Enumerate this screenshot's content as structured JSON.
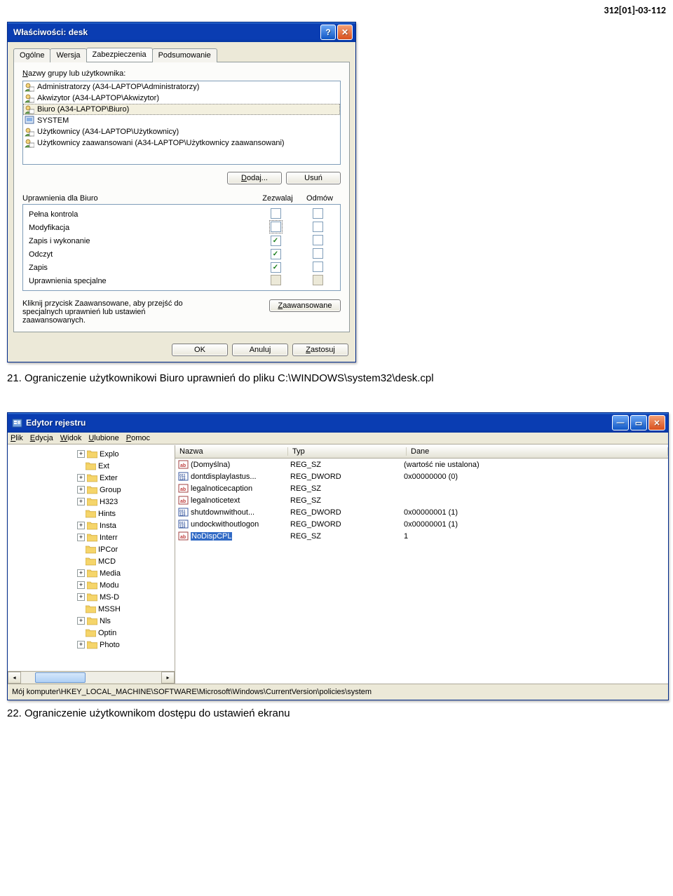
{
  "page_header": "312[01]-03-112",
  "dialog": {
    "title": "Właściwości: desk",
    "tabs": [
      "Ogólne",
      "Wersja",
      "Zabezpieczenia",
      "Podsumowanie"
    ],
    "active_tab": 2,
    "groups_label": "Nazwy grupy lub użytkownika:",
    "users": [
      "Administratorzy (A34-LAPTOP\\Administratorzy)",
      "Akwizytor (A34-LAPTOP\\Akwizytor)",
      "Biuro (A34-LAPTOP\\Biuro)",
      "SYSTEM",
      "Użytkownicy (A34-LAPTOP\\Użytkownicy)",
      "Użytkownicy zaawansowani (A34-LAPTOP\\Użytkownicy zaawansowani)"
    ],
    "selected_user_index": 2,
    "add_btn": "Dodaj...",
    "remove_btn": "Usuń",
    "perm_for": "Uprawnienia dla Biuro",
    "allow": "Zezwalaj",
    "deny": "Odmów",
    "permissions": [
      {
        "name": "Pełna kontrola",
        "allow": false,
        "deny": false,
        "allow_grey": false
      },
      {
        "name": "Modyfikacja",
        "allow": false,
        "deny": false,
        "allow_grey": false,
        "allow_focus": true
      },
      {
        "name": "Zapis i wykonanie",
        "allow": true,
        "deny": false,
        "allow_grey": false
      },
      {
        "name": "Odczyt",
        "allow": true,
        "deny": false,
        "allow_grey": false
      },
      {
        "name": "Zapis",
        "allow": true,
        "deny": false,
        "allow_grey": false
      },
      {
        "name": "Uprawnienia specjalne",
        "allow": false,
        "deny": false,
        "allow_grey": true
      }
    ],
    "adv_text": "Kliknij przycisk Zaawansowane, aby przejść do specjalnych uprawnień lub ustawień zaawansowanych.",
    "adv_btn": "Zaawansowane",
    "ok": "OK",
    "cancel": "Anuluj",
    "apply": "Zastosuj"
  },
  "caption1": "21. Ograniczenie użytkownikowi Biuro uprawnień do pliku C:\\WINDOWS\\system32\\desk.cpl",
  "regedit": {
    "title": "Edytor rejestru",
    "menu": [
      "Plik",
      "Edycja",
      "Widok",
      "Ulubione",
      "Pomoc"
    ],
    "tree": [
      {
        "exp": "+",
        "label": "Explo"
      },
      {
        "exp": "",
        "label": "Ext"
      },
      {
        "exp": "+",
        "label": "Exter"
      },
      {
        "exp": "+",
        "label": "Group"
      },
      {
        "exp": "+",
        "label": "H323"
      },
      {
        "exp": "",
        "label": "Hints"
      },
      {
        "exp": "+",
        "label": "Insta"
      },
      {
        "exp": "+",
        "label": "Interr"
      },
      {
        "exp": "",
        "label": "IPCor"
      },
      {
        "exp": "",
        "label": "MCD"
      },
      {
        "exp": "+",
        "label": "Media"
      },
      {
        "exp": "+",
        "label": "Modu"
      },
      {
        "exp": "+",
        "label": "MS-D"
      },
      {
        "exp": "",
        "label": "MSSH"
      },
      {
        "exp": "+",
        "label": "Nls"
      },
      {
        "exp": "",
        "label": "Optin"
      },
      {
        "exp": "+",
        "label": "Photo"
      }
    ],
    "columns": [
      "Nazwa",
      "Typ",
      "Dane"
    ],
    "values": [
      {
        "icon": "sz",
        "name": "(Domyślna)",
        "type": "REG_SZ",
        "data": "(wartość nie ustalona)"
      },
      {
        "icon": "dw",
        "name": "dontdisplaylastus...",
        "type": "REG_DWORD",
        "data": "0x00000000 (0)"
      },
      {
        "icon": "sz",
        "name": "legalnoticecaption",
        "type": "REG_SZ",
        "data": ""
      },
      {
        "icon": "sz",
        "name": "legalnoticetext",
        "type": "REG_SZ",
        "data": ""
      },
      {
        "icon": "dw",
        "name": "shutdownwithout...",
        "type": "REG_DWORD",
        "data": "0x00000001 (1)"
      },
      {
        "icon": "dw",
        "name": "undockwithoutlogon",
        "type": "REG_DWORD",
        "data": "0x00000001 (1)"
      },
      {
        "icon": "sz",
        "name": "NoDispCPL",
        "type": "REG_SZ",
        "data": "1",
        "selected": true
      }
    ],
    "status": "Mój komputer\\HKEY_LOCAL_MACHINE\\SOFTWARE\\Microsoft\\Windows\\CurrentVersion\\policies\\system"
  },
  "caption2": "22. Ograniczenie użytkownikom dostępu do ustawień ekranu"
}
